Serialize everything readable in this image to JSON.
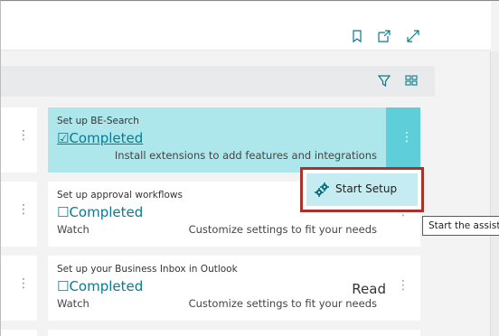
{
  "header": {
    "icons": [
      "bookmark-icon",
      "open-in-new-window-icon",
      "expand-icon"
    ]
  },
  "subbar": {
    "icons": [
      "filter-icon",
      "layout-switch-icon"
    ]
  },
  "cards": [
    {
      "title": "Set up BE-Search",
      "status": "☑Completed",
      "description": "Install extensions to add features and integrations",
      "active": true
    },
    {
      "title": "Set up approval workflows",
      "status": "☐Completed",
      "watch": "Watch",
      "description": "Customize settings to fit your needs"
    },
    {
      "title": "Set up your Business Inbox in Outlook",
      "status": "☐Completed",
      "read": "Read",
      "watch": "Watch",
      "description": "Customize settings to fit your needs"
    }
  ],
  "context_menu": {
    "item_label": "Start Setup",
    "item_icon": "puzzle-setup-icon"
  },
  "tooltip": {
    "text": "Start the assist"
  },
  "colors": {
    "accent": "#0b7a8e",
    "active_card": "#aee7eb",
    "active_band": "#5ecfd8",
    "highlight_border": "#a8332a"
  }
}
